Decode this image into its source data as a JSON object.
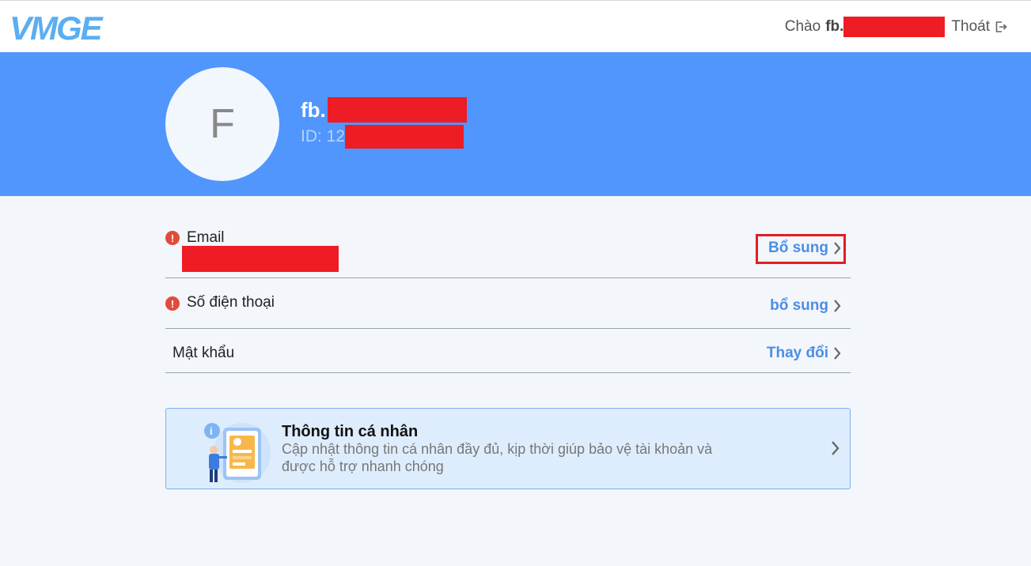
{
  "header": {
    "logo_text": "VMGE",
    "greeting": "Chào",
    "username_prefix": "fb.",
    "logout_label": "Thoát",
    "logout_icon": "logout-icon"
  },
  "profile": {
    "avatar_letter": "F",
    "name_prefix": "fb.",
    "id_prefix": "ID: 12"
  },
  "account_rows": [
    {
      "label": "Email",
      "action": "Bổ sung",
      "warning": true
    },
    {
      "label": "Số điện thoại",
      "action": "bổ sung",
      "warning": true
    },
    {
      "label": "Mật khẩu",
      "action": "Thay đổi",
      "warning": false
    }
  ],
  "personal_info_card": {
    "title": "Thông tin cá nhân",
    "description": "Cập nhật thông tin cá nhân đầy đủ, kịp thời giúp bảo vệ tài khoản và được hỗ trợ nhanh chóng"
  },
  "colors": {
    "banner": "#5196fd",
    "accent": "#4b8ee6",
    "warning": "#e14b3b",
    "redaction": "#ee1c25",
    "background": "#f3f6fa"
  }
}
